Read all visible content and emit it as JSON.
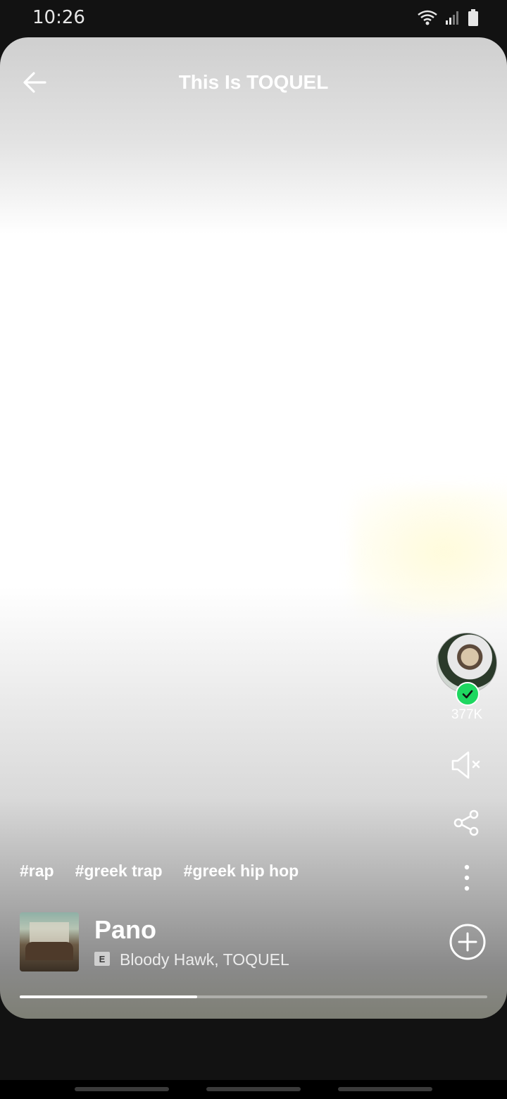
{
  "status_bar": {
    "time": "10:26",
    "icons": [
      "wifi-icon",
      "signal-icon",
      "battery-icon"
    ]
  },
  "header": {
    "title": "This Is TOQUEL",
    "back_icon": "arrow-left-icon"
  },
  "side_actions": {
    "follower_count": "377K",
    "mute_icon": "volume-mute-icon",
    "share_icon": "share-icon",
    "more_icon": "more-vertical-icon"
  },
  "tags": [
    "#rap",
    "#greek trap",
    "#greek hip hop"
  ],
  "track": {
    "title": "Pano",
    "explicit_label": "E",
    "artists": "Bloody Hawk, TOQUEL",
    "add_icon": "add-circle-icon"
  },
  "playback": {
    "progress": 0.38
  },
  "colors": {
    "accent": "#1ed760",
    "background": "#121212"
  }
}
